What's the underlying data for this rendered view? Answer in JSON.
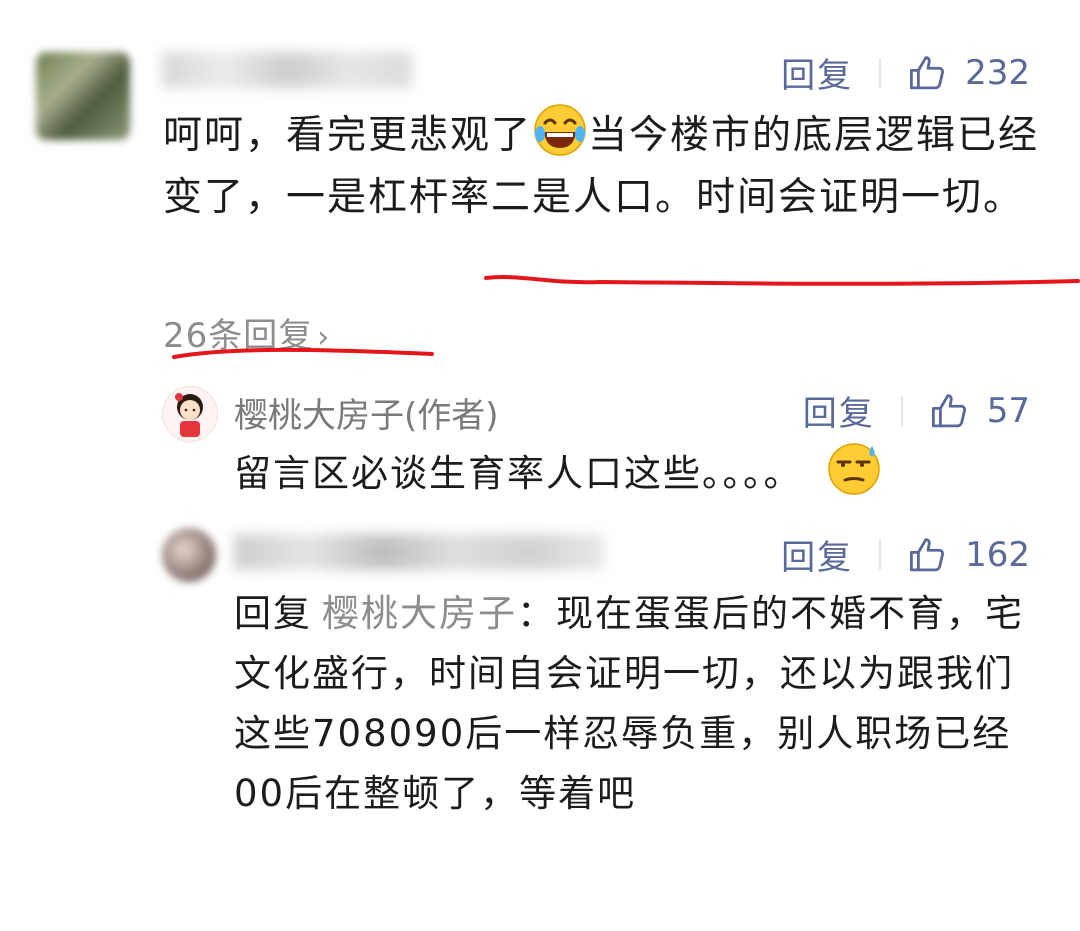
{
  "actions": {
    "reply_label": "回复"
  },
  "comments": [
    {
      "author": "",
      "likes": "232",
      "text_before_emoji": "呵呵，看完更悲观了",
      "emoji": "laughing-tears-emoji",
      "text_after_emoji": "当今楼市的底层逻辑已经变了，一是杠杆率二是人口。时间会证明一切。",
      "replies_link": "26条回复"
    }
  ],
  "replies": [
    {
      "author": "樱桃大房子(作者)",
      "likes": "57",
      "text": "留言区必谈生育率人口这些。。。。",
      "emoji": "sweat-smile-emoji"
    },
    {
      "author": "",
      "likes": "162",
      "reply_prefix": "回复",
      "reply_to": "樱桃大房子",
      "text": "：现在蛋蛋后的不婚不育，宅文化盛行，时间自会证明一切，还以为跟我们这些708090后一样忍辱负重，别人职场已经00后在整顿了，等着吧"
    }
  ],
  "colors": {
    "annotation_red": "#e5161b",
    "action_blue": "#58699a"
  }
}
